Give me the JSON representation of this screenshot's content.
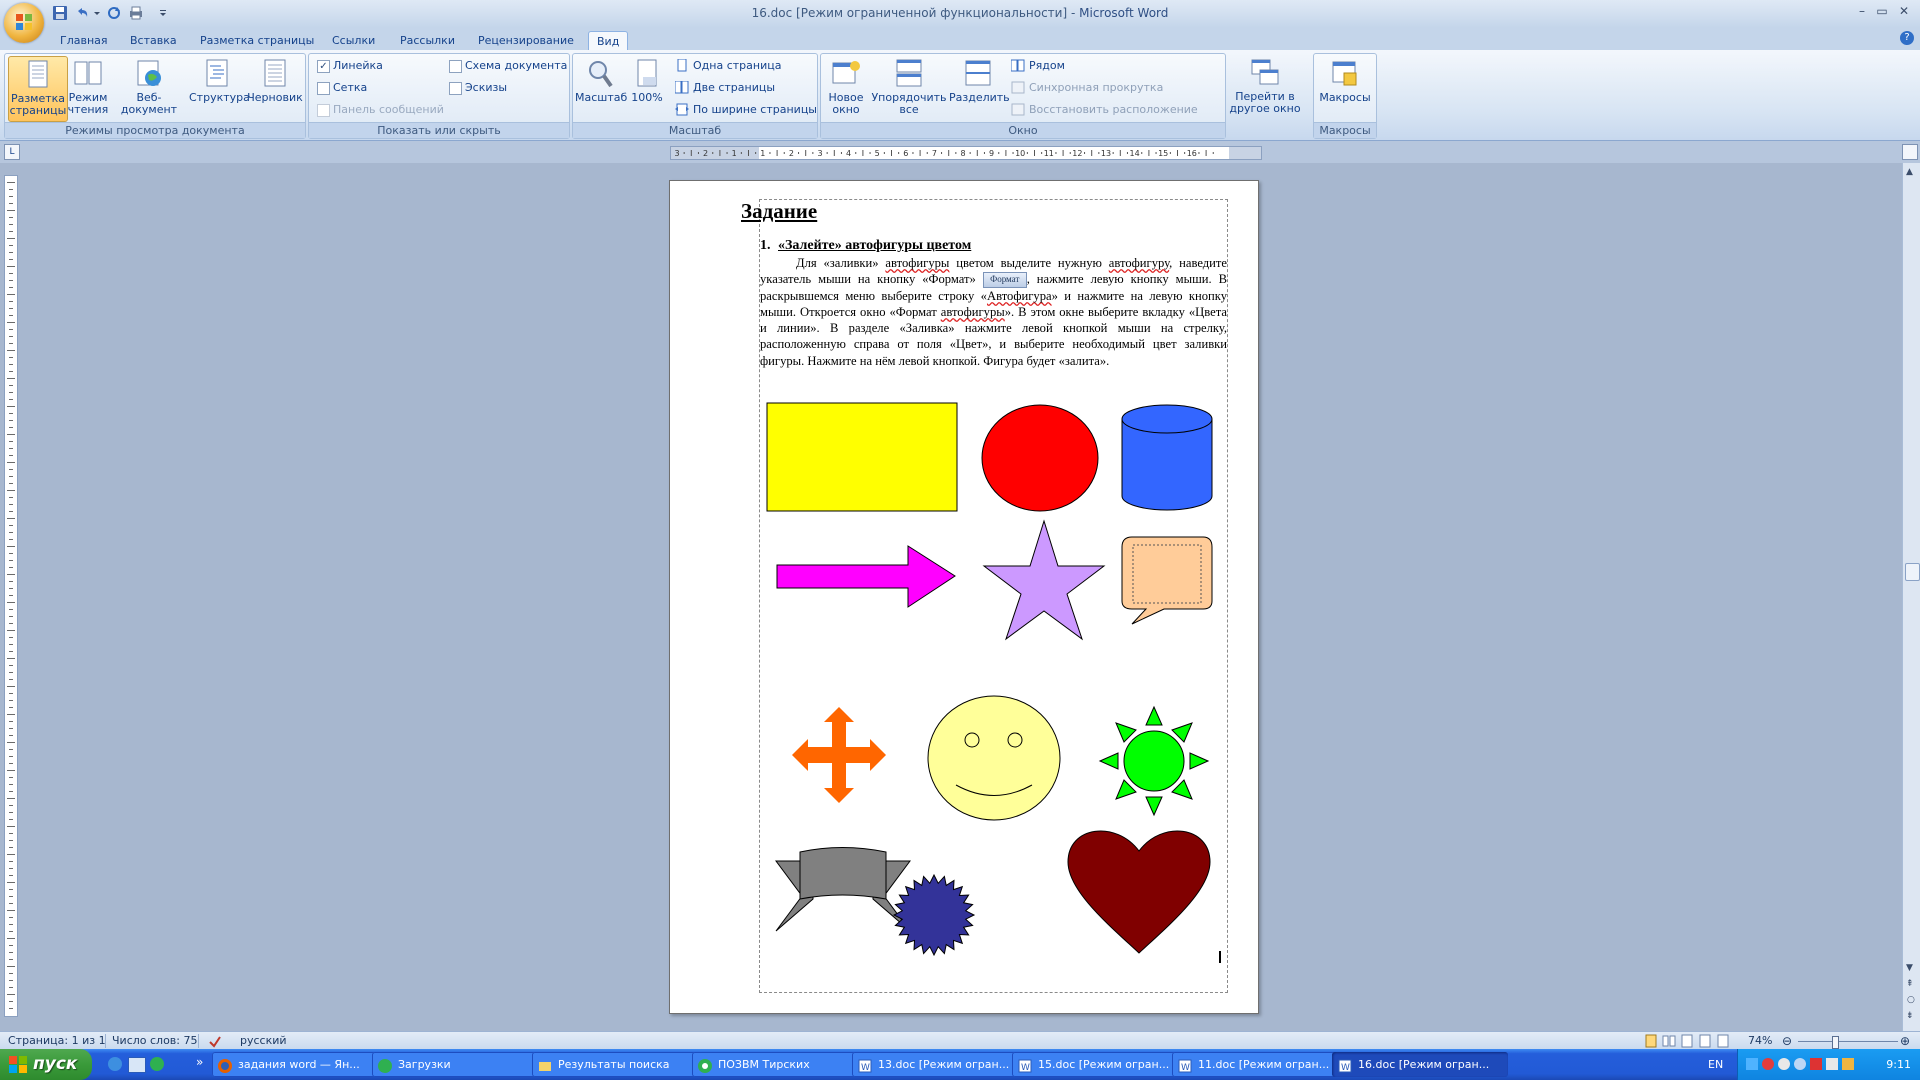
{
  "window": {
    "title": "16.doc [Режим ограниченной функциональности] - ",
    "app_name": "Microsoft Word",
    "buttons": {
      "minimize": "–",
      "maximize": "▭",
      "close": "✕"
    }
  },
  "tabs": [
    {
      "label": "Главная"
    },
    {
      "label": "Вставка"
    },
    {
      "label": "Разметка страницы"
    },
    {
      "label": "Ссылки"
    },
    {
      "label": "Рассылки"
    },
    {
      "label": "Рецензирование"
    },
    {
      "label": "Вид",
      "active": true
    }
  ],
  "ribbon": {
    "groups": {
      "views": {
        "label": "Режимы просмотра документа",
        "buttons": [
          {
            "label": "Разметка страницы",
            "active": true
          },
          {
            "label": "Режим чтения"
          },
          {
            "label": "Веб-документ"
          },
          {
            "label": "Структура"
          },
          {
            "label": "Черновик"
          }
        ]
      },
      "show_hide": {
        "label": "Показать или скрыть",
        "ruler": "Линейка",
        "grid": "Сетка",
        "message_bar": "Панель сообщений",
        "doc_map": "Схема документа",
        "thumbnails": "Эскизы"
      },
      "zoom": {
        "label": "Масштаб",
        "zoom_btn": "Масштаб",
        "hundred": "100%",
        "one_page": "Одна страница",
        "two_pages": "Две страницы",
        "page_width": "По ширине страницы"
      },
      "window": {
        "label": "Окно",
        "new_window": "Новое окно",
        "arrange_all": "Упорядочить все",
        "split": "Разделить",
        "side_by_side": "Рядом",
        "sync_scroll": "Синхронная прокрутка",
        "reset_pos": "Восстановить расположение окна",
        "switch": "Перейти в другое окно"
      },
      "macros": {
        "label": "Макросы",
        "macros_btn": "Макросы"
      }
    }
  },
  "ruler": {
    "ticks": [
      "3",
      "2",
      "1",
      "1",
      "2",
      "3",
      "4",
      "5",
      "6",
      "7",
      "8",
      "9",
      "10",
      "11",
      "12",
      "13",
      "14",
      "15",
      "16"
    ]
  },
  "document": {
    "title": "Задание",
    "heading_num": "1.",
    "heading": "«Залейте» автофигуры цветом",
    "para_a": "Для «заливки» ",
    "para_sp1": "автофигуры",
    "para_b": " цветом выделите нужную ",
    "para_sp2": "автофигуру",
    "para_c": ", наведите указатель мыши на кнопку «Формат» ",
    "format_button": "Формат",
    "para_d": ", нажмите левую кнопку мыши. В раскрывшемся меню выберите строку «",
    "para_sp3": "Автофигура",
    "para_e": "» и нажмите на левую кнопку мыши. Откроется окно «Формат ",
    "para_sp4": "автофигуры",
    "para_f": "». В этом окне выберите вкладку «Цвета и линии». В разделе «Заливка» нажмите левой кнопкой мыши на стрелку, расположенную справа от поля «Цвет», и выберите необходимый цвет заливки фигуры. Нажмите на нём левой кнопкой. Фигура будет «залита».",
    "shape_colors": {
      "rectangle": "#ffff00",
      "circle": "#ff0000",
      "cylinder": "#3366ff",
      "arrow": "#ff00ff",
      "star": "#cc99ff",
      "callout": "#ffcc99",
      "quad_arrow": "#ff6600",
      "smiley": "#ffff99",
      "sun": "#00ff00",
      "ribbon": "#808080",
      "seal": "#333399",
      "heart": "#800000"
    }
  },
  "statusbar": {
    "page": "Страница: 1 из 1",
    "words": "Число слов: 75",
    "language": "русский",
    "zoom": "74%"
  },
  "taskbar": {
    "start": "пуск",
    "tasks": [
      {
        "label": "задания word — Ян..."
      },
      {
        "label": "Загрузки"
      },
      {
        "label": "Результаты поиска"
      },
      {
        "label": "ПОЗВМ Тирских"
      },
      {
        "label": "13.doc [Режим огран..."
      },
      {
        "label": "15.doc [Режим огран..."
      },
      {
        "label": "11.doc [Режим огран..."
      },
      {
        "label": "16.doc [Режим огран...",
        "active": true
      }
    ],
    "lang": "EN",
    "clock": "9:11"
  }
}
